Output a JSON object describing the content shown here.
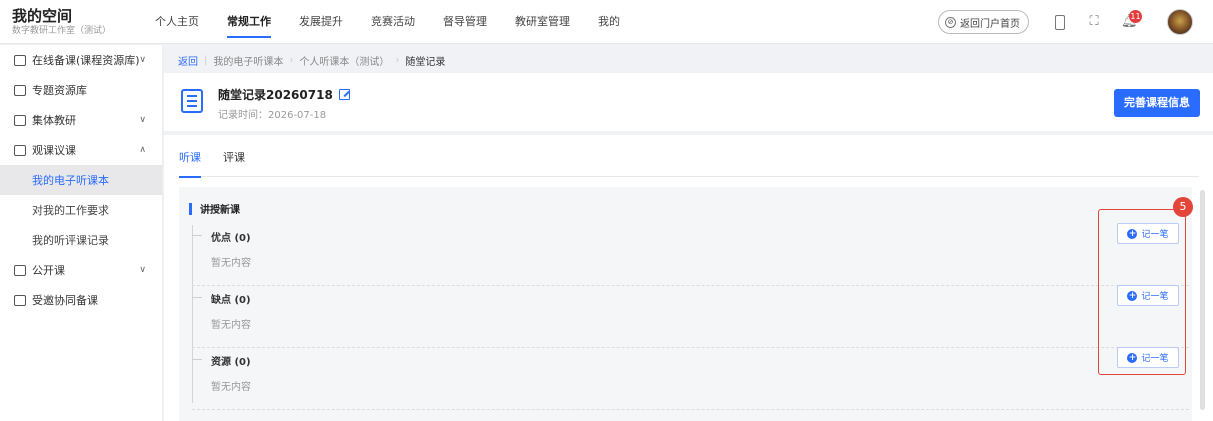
{
  "brand": {
    "title": "我的空间",
    "subtitle": "数字教研工作室（测试）"
  },
  "nav": [
    {
      "label": "个人主页",
      "active": false
    },
    {
      "label": "常规工作",
      "active": true
    },
    {
      "label": "发展提升",
      "active": false
    },
    {
      "label": "竞赛活动",
      "active": false
    },
    {
      "label": "督导管理",
      "active": false
    },
    {
      "label": "教研室管理",
      "active": false
    },
    {
      "label": "我的",
      "active": false
    }
  ],
  "topbar": {
    "portal_label": "返回门户首页",
    "notification_count": "11"
  },
  "sidebar": {
    "items": [
      {
        "label": "在线备课(课程资源库)",
        "arrow": "∨"
      },
      {
        "label": "专题资源库",
        "arrow": ""
      },
      {
        "label": "集体教研",
        "arrow": "∨"
      },
      {
        "label": "观课议课",
        "arrow": "∧"
      },
      {
        "label": "我的电子听课本",
        "sub": true,
        "active": true
      },
      {
        "label": "对我的工作要求",
        "sub": true
      },
      {
        "label": "我的听评课记录",
        "sub": true
      },
      {
        "label": "公开课",
        "arrow": "∨"
      },
      {
        "label": "受邀协同备课",
        "arrow": ""
      }
    ]
  },
  "breadcrumb": {
    "back": "返回",
    "path": [
      "我的电子听课本",
      "个人听课本（测试）"
    ],
    "current": "随堂记录"
  },
  "record": {
    "title": "随堂记录20260718",
    "time": "记录时间：2026-07-18",
    "complete_button": "完善课程信息"
  },
  "tabs": [
    {
      "label": "听课",
      "active": true
    },
    {
      "label": "评课",
      "active": false
    }
  ],
  "section": {
    "title": "讲授新课",
    "entries": [
      {
        "label": "优点 (0)",
        "empty": "暂无内容",
        "button": "记一笔"
      },
      {
        "label": "缺点 (0)",
        "empty": "暂无内容",
        "button": "记一笔"
      },
      {
        "label": "资源 (0)",
        "empty": "暂无内容",
        "button": "记一笔"
      }
    ]
  },
  "annotation": {
    "number": "5",
    "color": "#e3453a"
  },
  "colors": {
    "accent": "#2a6cff"
  }
}
